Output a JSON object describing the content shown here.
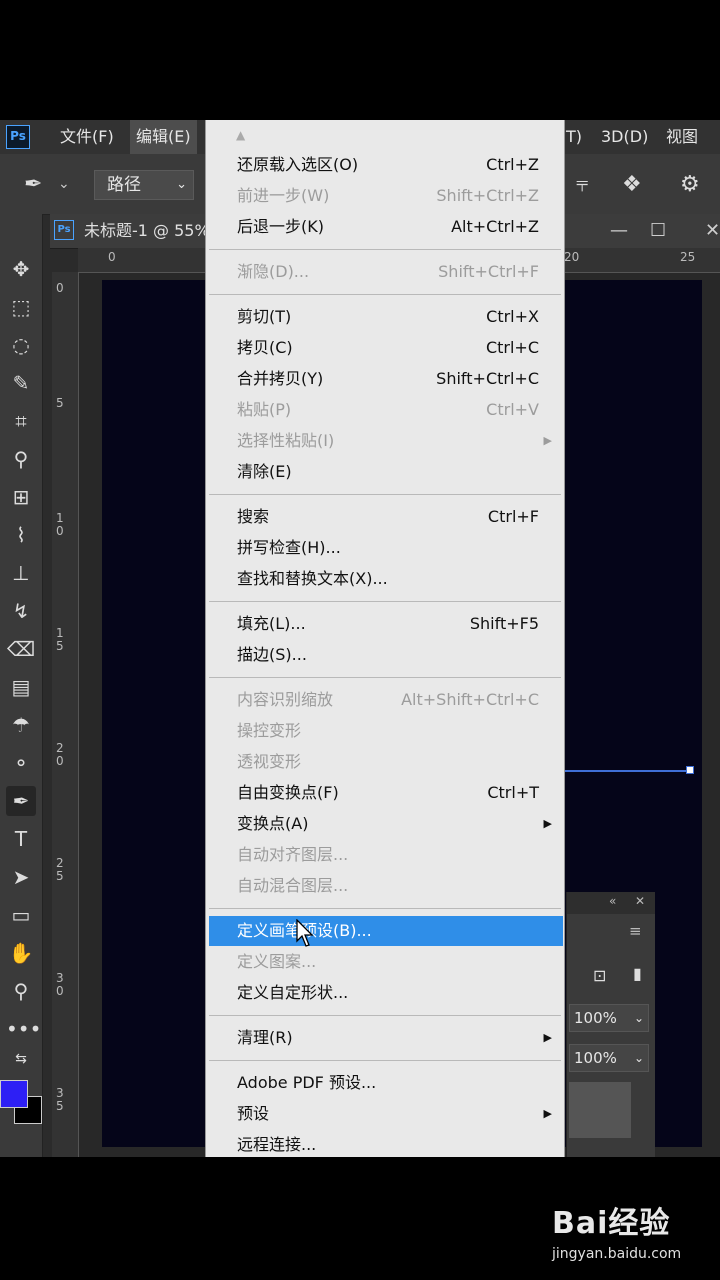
{
  "app": {
    "logo": "Ps"
  },
  "menubar": {
    "items": [
      {
        "label": "文件(F)",
        "active": false
      },
      {
        "label": "编辑(E)",
        "active": true
      },
      {
        "label": "T)",
        "active": false
      },
      {
        "label": "3D(D)",
        "active": false
      },
      {
        "label": "视图(V",
        "active": false
      }
    ]
  },
  "options": {
    "mode_value": "路径",
    "tool_icon": "pen-icon"
  },
  "document": {
    "ps_icon": "Ps",
    "title": "未标题-1 @ 55%",
    "min_label": "—",
    "max_label": "☐",
    "close_label": "✕"
  },
  "ruler": {
    "top": [
      "0",
      "20",
      "25"
    ],
    "left": [
      "0",
      "5",
      "1\n0",
      "1\n5",
      "2\n0",
      "2\n5",
      "3\n0",
      "3\n5"
    ]
  },
  "panel": {
    "opacity": "100%",
    "fill": "100%"
  },
  "menu": {
    "items": [
      {
        "label": "还原载入选区(O)",
        "shortcut": "Ctrl+Z",
        "disabled": false,
        "submenu": false
      },
      {
        "label": "前进一步(W)",
        "shortcut": "Shift+Ctrl+Z",
        "disabled": true,
        "submenu": false
      },
      {
        "label": "后退一步(K)",
        "shortcut": "Alt+Ctrl+Z",
        "disabled": false,
        "submenu": false
      },
      {
        "sep": true
      },
      {
        "label": "渐隐(D)...",
        "shortcut": "Shift+Ctrl+F",
        "disabled": true,
        "submenu": false
      },
      {
        "sep": true
      },
      {
        "label": "剪切(T)",
        "shortcut": "Ctrl+X",
        "disabled": false,
        "submenu": false
      },
      {
        "label": "拷贝(C)",
        "shortcut": "Ctrl+C",
        "disabled": false,
        "submenu": false
      },
      {
        "label": "合并拷贝(Y)",
        "shortcut": "Shift+Ctrl+C",
        "disabled": false,
        "submenu": false
      },
      {
        "label": "粘贴(P)",
        "shortcut": "Ctrl+V",
        "disabled": true,
        "submenu": false
      },
      {
        "label": "选择性粘贴(I)",
        "shortcut": "",
        "disabled": true,
        "submenu": true
      },
      {
        "label": "清除(E)",
        "shortcut": "",
        "disabled": false,
        "submenu": false
      },
      {
        "sep": true
      },
      {
        "label": "搜索",
        "shortcut": "Ctrl+F",
        "disabled": false,
        "submenu": false
      },
      {
        "label": "拼写检查(H)...",
        "shortcut": "",
        "disabled": false,
        "submenu": false
      },
      {
        "label": "查找和替换文本(X)...",
        "shortcut": "",
        "disabled": false,
        "submenu": false
      },
      {
        "sep": true
      },
      {
        "label": "填充(L)...",
        "shortcut": "Shift+F5",
        "disabled": false,
        "submenu": false
      },
      {
        "label": "描边(S)...",
        "shortcut": "",
        "disabled": false,
        "submenu": false
      },
      {
        "sep": true
      },
      {
        "label": "内容识别缩放",
        "shortcut": "Alt+Shift+Ctrl+C",
        "disabled": true,
        "submenu": false
      },
      {
        "label": "操控变形",
        "shortcut": "",
        "disabled": true,
        "submenu": false
      },
      {
        "label": "透视变形",
        "shortcut": "",
        "disabled": true,
        "submenu": false
      },
      {
        "label": "自由变换点(F)",
        "shortcut": "Ctrl+T",
        "disabled": false,
        "submenu": false
      },
      {
        "label": "变换点(A)",
        "shortcut": "",
        "disabled": false,
        "submenu": true
      },
      {
        "label": "自动对齐图层...",
        "shortcut": "",
        "disabled": true,
        "submenu": false
      },
      {
        "label": "自动混合图层...",
        "shortcut": "",
        "disabled": true,
        "submenu": false
      },
      {
        "sep": true
      },
      {
        "label": "定义画笔预设(B)...",
        "shortcut": "",
        "disabled": false,
        "submenu": false,
        "highlighted": true
      },
      {
        "label": "定义图案...",
        "shortcut": "",
        "disabled": true,
        "submenu": false
      },
      {
        "label": "定义自定形状...",
        "shortcut": "",
        "disabled": false,
        "submenu": false
      },
      {
        "sep": true
      },
      {
        "label": "清理(R)",
        "shortcut": "",
        "disabled": false,
        "submenu": true
      },
      {
        "sep": true
      },
      {
        "label": "Adobe PDF 预设...",
        "shortcut": "",
        "disabled": false,
        "submenu": false
      },
      {
        "label": "预设",
        "shortcut": "",
        "disabled": false,
        "submenu": true
      },
      {
        "label": "远程连接...",
        "shortcut": "",
        "disabled": false,
        "submenu": false
      }
    ]
  },
  "watermark": {
    "brand": "Bai经验",
    "url": "jingyan.baidu.com"
  },
  "colors": {
    "accent": "#2f8ee8",
    "foreground_swatch": "#2d1ff5",
    "canvas": "#050519"
  }
}
